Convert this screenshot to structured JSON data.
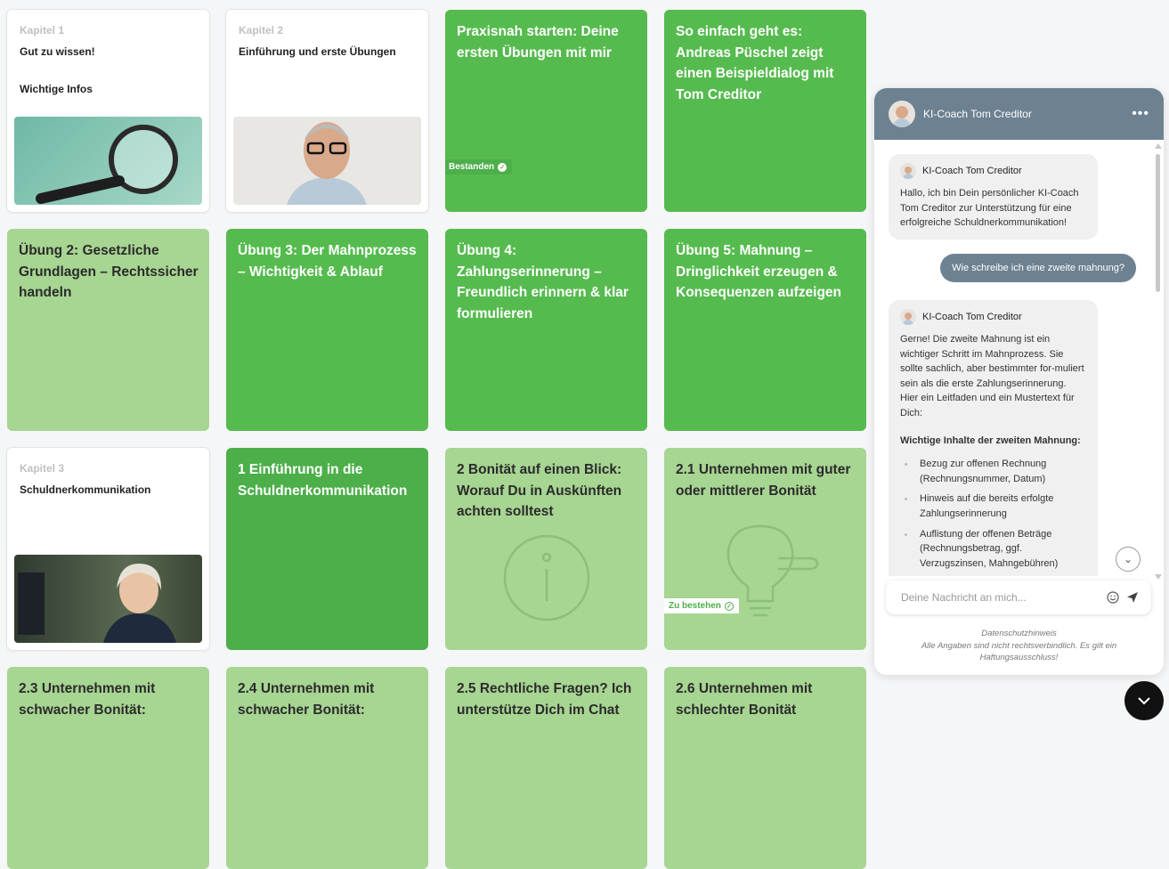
{
  "cards": [
    {
      "kapitel": "Kapitel 1",
      "title": "Gut zu wissen!",
      "subtitle": "Wichtige Infos"
    },
    {
      "kapitel": "Kapitel 2",
      "title": "Einführung und erste Übungen"
    },
    {
      "title": "Praxisnah starten: Deine ersten Übungen mit mir",
      "badge": "Bestanden"
    },
    {
      "title": "So einfach geht es: Andreas Püschel zeigt einen Beispieldialog mit Tom Creditor"
    },
    {
      "title": "Übung 2: Gesetzliche Grundlagen – Rechtssicher handeln"
    },
    {
      "title": "Übung 3: Der Mahnprozess – Wichtigkeit & Ablauf"
    },
    {
      "title": "Übung 4: Zahlungserinnerung – Freundlich erinnern & klar formulieren"
    },
    {
      "title": "Übung 5: Mahnung – Dringlichkeit erzeugen & Konsequenzen aufzeigen"
    },
    {
      "kapitel": "Kapitel 3",
      "title": "Schuldnerkommunikation"
    },
    {
      "title": "1 Einführung in die Schuldnerkommunikation"
    },
    {
      "title": "2 Bonität auf einen Blick: Worauf Du in Auskünften achten solltest"
    },
    {
      "title": "2.1 Unternehmen mit guter oder mittlerer Bonität",
      "badge": "Zu bestehen"
    },
    {
      "title": "2.3 Unternehmen mit schwacher Bonität:"
    },
    {
      "title": "2.4 Unternehmen mit schwacher Bonität:"
    },
    {
      "title": "2.5 Rechtliche Fragen? Ich unterstütze Dich im Chat"
    },
    {
      "title": "2.6 Unternehmen mit schlechter Bonität"
    }
  ],
  "chat": {
    "header_title": "KI-Coach Tom Creditor",
    "bot_name": "KI-Coach Tom Creditor",
    "msg1": "Hallo, ich bin Dein persönlicher KI-Coach Tom Creditor zur Unterstützung für eine erfolgreiche Schuldnerkommunikation!",
    "user_msg": "Wie schreibe ich eine zweite mahnung?",
    "msg2_intro": "Gerne! Die zweite Mahnung ist ein wichtiger Schritt im Mahnprozess. Sie sollte sachlich, aber bestimmter for-muliert sein als die erste Zahlungserinnerung. Hier ein Leitfaden und ein Mustertext für Dich:",
    "msg2_heading": "Wichtige Inhalte der zweiten Mahnung:",
    "msg2_items": [
      "Bezug zur offenen Rechnung (Rechnungsnummer, Datum)",
      "Hinweis auf die bereits erfolgte Zahlungserinnerung",
      "Auflistung der offenen Beträge (Rechnungsbetrag, ggf. Verzugszinsen, Mahngebühren)"
    ],
    "input_placeholder": "Deine Nachricht an mich...",
    "footer_line1": "Datenschutzhinweis",
    "footer_line2": "Alle Angaben sind nicht rechtsverbindlich. Es gilt ein",
    "footer_line3": "Haftungsausschluss!"
  },
  "colors": {
    "green": "#56bb4f",
    "light_green": "#a7d592",
    "header": "#6d8191"
  }
}
